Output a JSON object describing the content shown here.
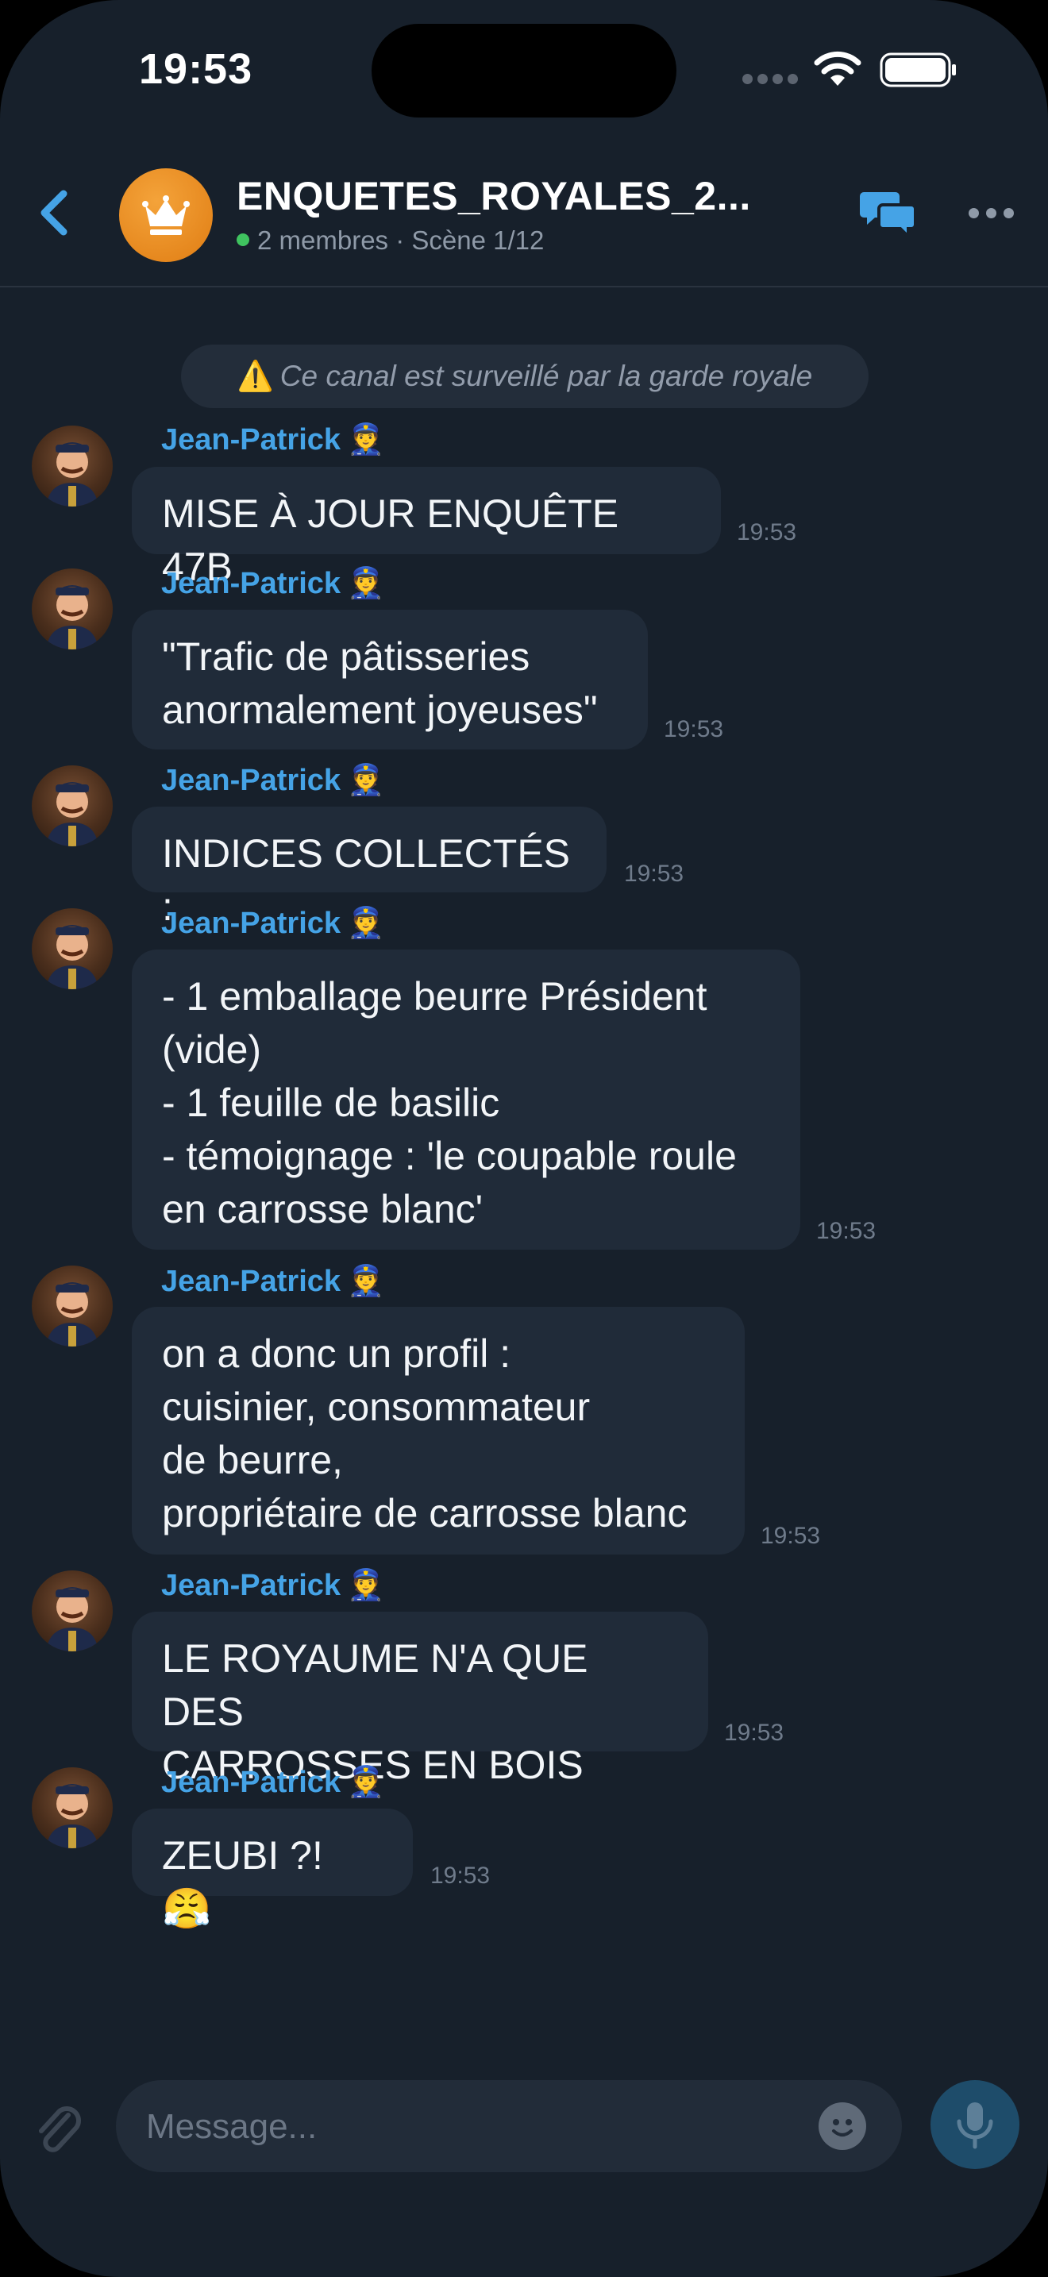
{
  "status_bar": {
    "time": "19:53"
  },
  "header": {
    "title": "ENQUETES_ROYALES_2...",
    "subtitle": "2 membres · Scène 1/12",
    "avatar_icon": "crown-icon",
    "colors": {
      "accent": "#45a3e6",
      "avatar": "#e8891d",
      "online": "#3fc35f"
    }
  },
  "system_notice": {
    "icon": "⚠️",
    "text": "Ce canal est surveillé par la garde royale"
  },
  "messages": [
    {
      "sender": "Jean-Patrick",
      "badge": "👮",
      "text": "MISE À JOUR ENQUÊTE 47B",
      "time": "19:53"
    },
    {
      "sender": "Jean-Patrick",
      "badge": "👮",
      "text": "\"Trafic de pâtisseries\nanormalement joyeuses\"",
      "time": "19:53"
    },
    {
      "sender": "Jean-Patrick",
      "badge": "👮",
      "text": "INDICES COLLECTÉS :",
      "time": "19:53"
    },
    {
      "sender": "Jean-Patrick",
      "badge": "👮",
      "text": "- 1 emballage beurre Président\n(vide)\n- 1 feuille de basilic\n- témoignage : 'le coupable roule\nen carrosse blanc'",
      "time": "19:53"
    },
    {
      "sender": "Jean-Patrick",
      "badge": "👮",
      "text": "on a donc un profil :\ncuisinier, consommateur\nde beurre,\npropriétaire de carrosse blanc",
      "time": "19:53"
    },
    {
      "sender": "Jean-Patrick",
      "badge": "👮",
      "text": "LE ROYAUME N'A QUE DES\nCARROSSES EN BOIS",
      "time": "19:53"
    },
    {
      "sender": "Jean-Patrick",
      "badge": "👮",
      "text": "ZEUBI ?! 😤",
      "time": "19:53"
    }
  ],
  "composer": {
    "placeholder": "Message..."
  }
}
